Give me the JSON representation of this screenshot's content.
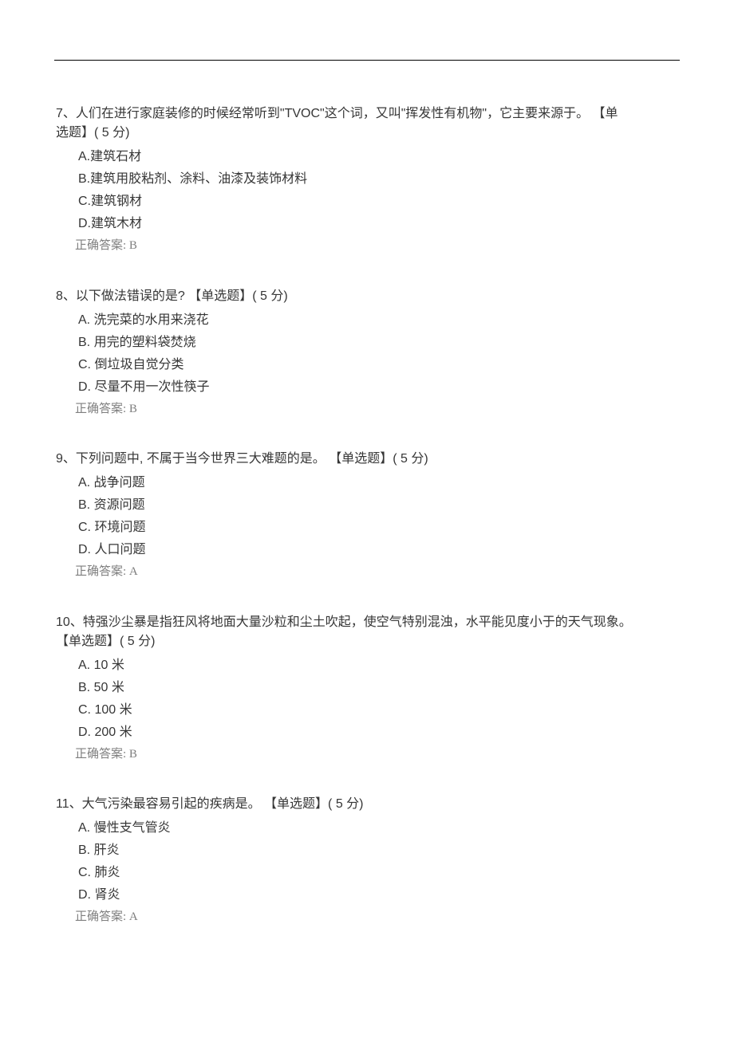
{
  "questions": [
    {
      "number": "7",
      "stem_lines": [
        "7、人们在进行家庭装修的时候经常听到\"TVOC\"这个词，又叫\"挥发性有机物\"，它主要来源于。  【单",
        "选题】( 5 分)"
      ],
      "options": [
        {
          "letter": "A.",
          "text": "建筑石材",
          "sans": true,
          "spaced": false
        },
        {
          "letter": "B.",
          "text": "建筑用胶粘剂、涂料、油漆及装饰材料",
          "sans": true,
          "spaced": false
        },
        {
          "letter": "C.",
          "text": "建筑钢材",
          "sans": true,
          "spaced": false
        },
        {
          "letter": "D.",
          "text": "建筑木材",
          "sans": true,
          "spaced": false
        }
      ],
      "answer": "正确答案:  B"
    },
    {
      "number": "8",
      "stem_lines": [
        "8、以下做法错误的是?    【单选题】( 5 分)"
      ],
      "options": [
        {
          "letter": "A.",
          "text": "洗完菜的水用来浇花",
          "sans": false,
          "spaced": true
        },
        {
          "letter": "B.",
          "text": "用完的塑料袋焚烧",
          "sans": false,
          "spaced": true
        },
        {
          "letter": "C.",
          "text": "倒垃圾自觉分类",
          "sans": false,
          "spaced": true
        },
        {
          "letter": "D.",
          "text": "尽量不用一次性筷子",
          "sans": false,
          "spaced": true
        }
      ],
      "answer": "正确答案:  B"
    },
    {
      "number": "9",
      "stem_lines": [
        "9、下列问题中,  不属于当今世界三大难题的是。  【单选题】( 5 分)"
      ],
      "options": [
        {
          "letter": "A.",
          "text": "战争问题",
          "sans": false,
          "spaced": true
        },
        {
          "letter": "B.",
          "text": "资源问题",
          "sans": false,
          "spaced": true
        },
        {
          "letter": "C.",
          "text": "环境问题",
          "sans": false,
          "spaced": true
        },
        {
          "letter": "D.",
          "text": "人口问题",
          "sans": false,
          "spaced": true
        }
      ],
      "answer": "正确答案:  A"
    },
    {
      "number": "10",
      "stem_lines": [
        "10、特强沙尘暴是指狂风将地面大量沙粒和尘土吹起，使空气特别混浊，水平能见度小于的天气现象。",
        "【单选题】( 5 分)"
      ],
      "options": [
        {
          "letter": "A.",
          "text": "10 米",
          "sans": true,
          "spaced": true
        },
        {
          "letter": "B.",
          "text": "50 米",
          "sans": true,
          "spaced": true
        },
        {
          "letter": "C.",
          "text": "100 米",
          "sans": true,
          "spaced": true
        },
        {
          "letter": "D.",
          "text": "200 米",
          "sans": true,
          "spaced": true
        }
      ],
      "answer": "正确答案:  B"
    },
    {
      "number": "11",
      "stem_lines": [
        "11、大气污染最容易引起的疾病是。  【单选题】( 5 分)"
      ],
      "options": [
        {
          "letter": "A.",
          "text": "慢性支气管炎",
          "sans": false,
          "spaced": true
        },
        {
          "letter": "B.",
          "text": "肝炎",
          "sans": false,
          "spaced": true
        },
        {
          "letter": "C.",
          "text": "肺炎",
          "sans": false,
          "spaced": true
        },
        {
          "letter": "D.",
          "text": "肾炎",
          "sans": false,
          "spaced": true
        }
      ],
      "answer": "正确答案:  A"
    }
  ]
}
